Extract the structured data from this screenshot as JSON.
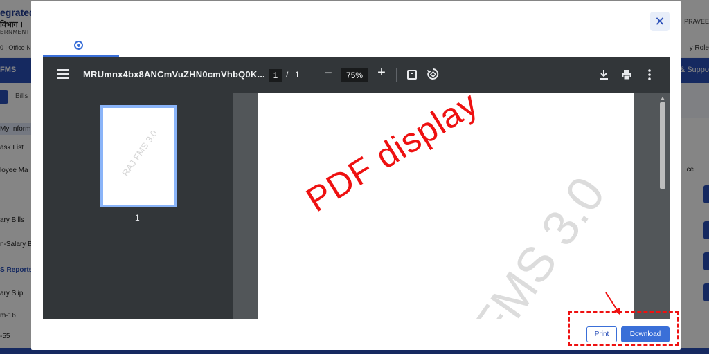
{
  "background": {
    "logo_line1": "egrated",
    "logo_line2": "विभाग ।",
    "logo_line3": "ERNMENT",
    "office": "0 | Office N",
    "user": "PRAVEE",
    "role": "y Role",
    "nav_left": "FMS",
    "nav_right": "& Suppo",
    "bills_tab": "Bills",
    "sidebar": [
      {
        "label": "My Inform",
        "style": "hl"
      },
      {
        "label": "ask List",
        "style": ""
      },
      {
        "label": "loyee Ma",
        "style": ""
      },
      {
        "label": "ary Bills",
        "style": ""
      },
      {
        "label": "n-Salary B",
        "style": ""
      },
      {
        "label": "S Reports",
        "style": "blue"
      },
      {
        "label": "ary Slip",
        "style": ""
      },
      {
        "label": "m-16",
        "style": ""
      },
      {
        "label": "-55",
        "style": ""
      }
    ],
    "right_col_header": "ce"
  },
  "modal": {
    "close_icon": "close-icon",
    "tab_icon": "radio-selected-icon"
  },
  "pdf_viewer": {
    "filename": "MRUmnx4bx8ANCmVuZHN0cmVhbQ0K...",
    "current_page": "1",
    "page_separator": "/",
    "total_pages": "1",
    "zoom_minus": "−",
    "zoom": "75%",
    "zoom_plus": "+",
    "thumbnail_label": "1",
    "thumbnail_watermark": "RAJ FMS 3.0",
    "page_watermark": "FMS 3.0",
    "annotation": "PDF display",
    "icons": {
      "menu": "menu-icon",
      "fit": "fit-to-page-icon",
      "rotate": "rotate-icon",
      "download": "download-icon",
      "print": "print-icon",
      "more": "more-vert-icon"
    }
  },
  "footer": {
    "print_label": "Print",
    "download_label": "Download"
  },
  "colors": {
    "accent": "#3a6fd8",
    "annotation": "#ee1111",
    "toolbar": "#323639"
  }
}
